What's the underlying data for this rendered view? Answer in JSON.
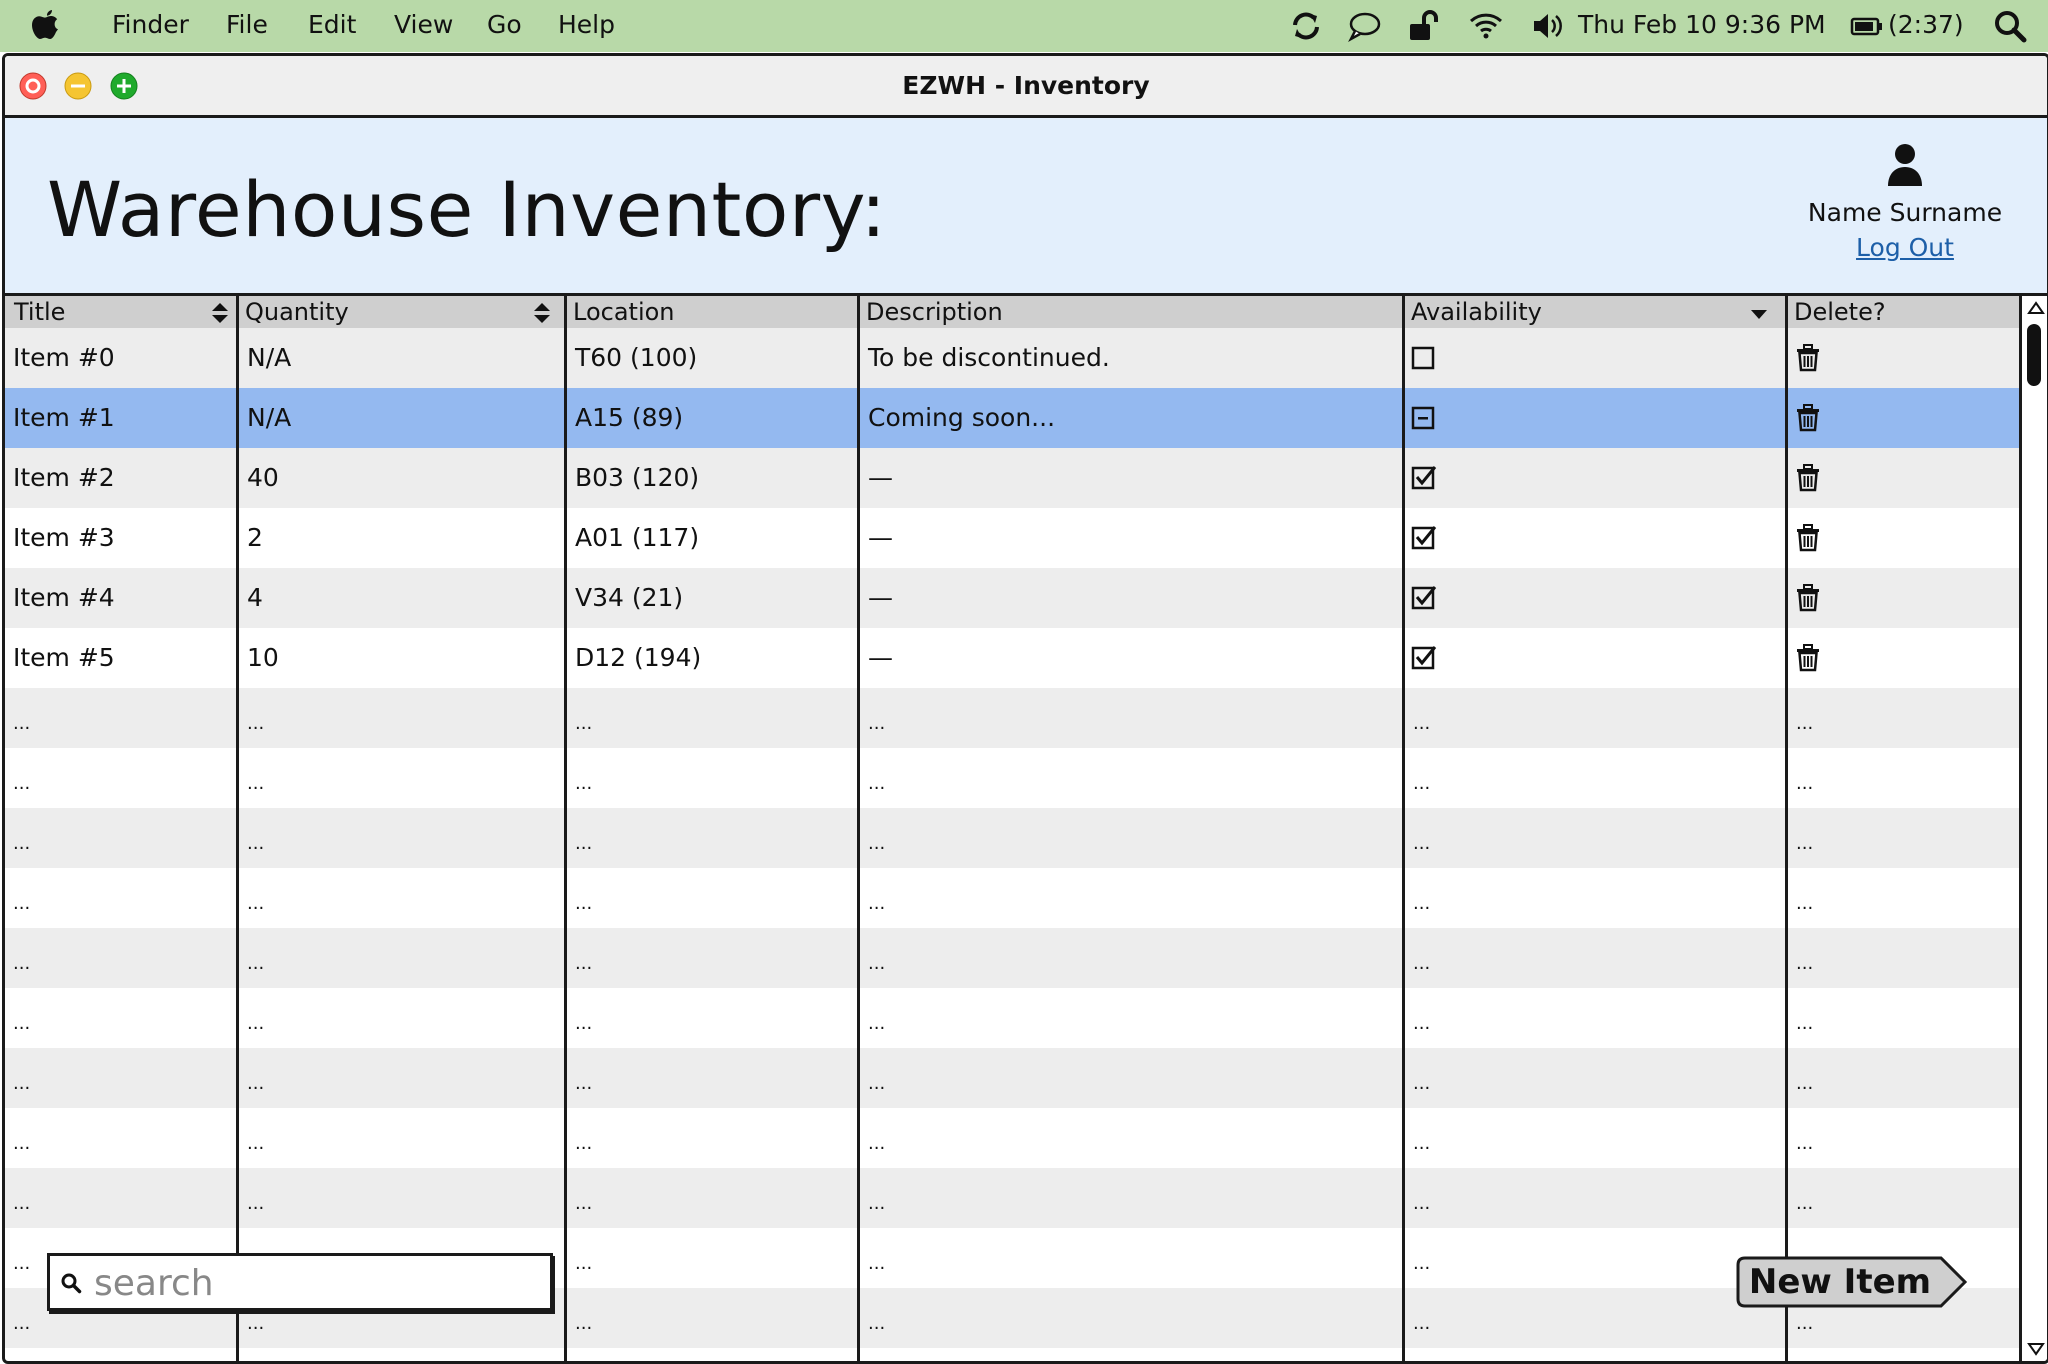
{
  "menubar": {
    "items": [
      "Finder",
      "File",
      "Edit",
      "View",
      "Go",
      "Help"
    ],
    "datetime": "Thu Feb 10  9:36 PM",
    "battery": "(2:37)",
    "icons": [
      "apple-icon",
      "sync-icon",
      "chat-icon",
      "lock-icon",
      "wifi-icon",
      "volume-icon",
      "battery-icon",
      "search-icon"
    ]
  },
  "window": {
    "title": "EZWH - Inventory"
  },
  "header": {
    "title": "Warehouse Inventory:",
    "user_name": "Name Surname",
    "logout_label": "Log Out"
  },
  "table": {
    "columns": [
      "Title",
      "Quantity",
      "Location",
      "Description",
      "Availability",
      "Delete?"
    ],
    "rows": [
      {
        "title": "Item #0",
        "quantity": "N/A",
        "location": "T60 (100)",
        "description": "To be discontinued.",
        "availability": "unchecked"
      },
      {
        "title": "Item #1",
        "quantity": "N/A",
        "location": "A15 (89)",
        "description": "Coming soon...",
        "availability": "indeterminate",
        "selected": true
      },
      {
        "title": "Item #2",
        "quantity": "40",
        "location": "B03 (120)",
        "description": "—",
        "availability": "checked"
      },
      {
        "title": "Item #3",
        "quantity": "2",
        "location": "A01 (117)",
        "description": "—",
        "availability": "checked"
      },
      {
        "title": "Item #4",
        "quantity": "4",
        "location": "V34 (21)",
        "description": "—",
        "availability": "checked"
      },
      {
        "title": "Item #5",
        "quantity": "10",
        "location": "D12 (194)",
        "description": "—",
        "availability": "checked"
      }
    ],
    "placeholder_text": "...",
    "placeholder_rows": 11
  },
  "search": {
    "placeholder": "search"
  },
  "new_item_label": "New Item",
  "colors": {
    "menubar": "#b8d9a8",
    "header": "#e3effc",
    "selected_row": "#94b9f0",
    "alt_row": "#ededed",
    "link": "#1d5fa8"
  }
}
